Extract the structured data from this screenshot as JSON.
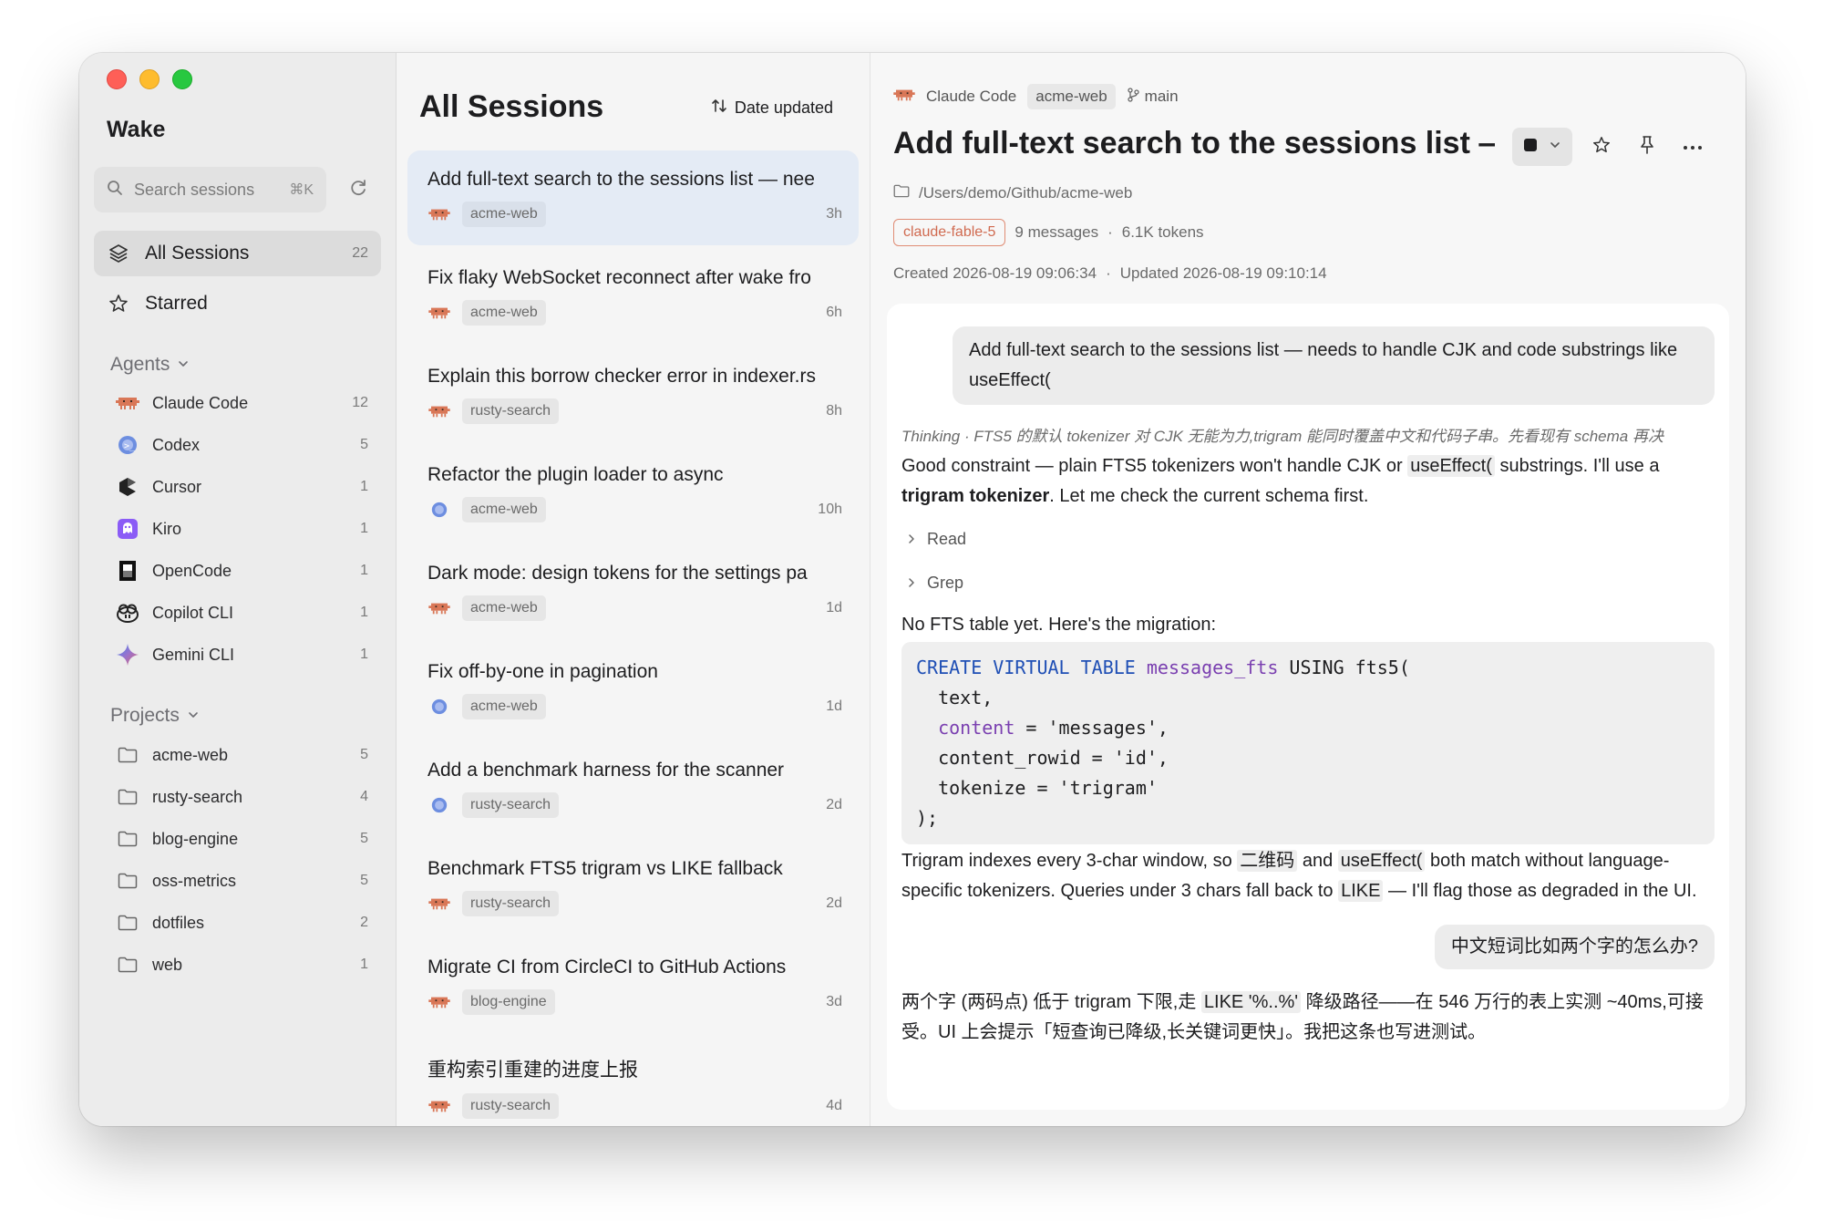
{
  "app": {
    "title": "Wake"
  },
  "sidebar": {
    "search_placeholder": "Search sessions",
    "search_shortcut": "⌘K",
    "nav": [
      {
        "label": "All Sessions",
        "count": "22",
        "icon": "layers-icon"
      },
      {
        "label": "Starred",
        "count": "",
        "icon": "star-icon"
      }
    ],
    "agents_header": "Agents",
    "agents": [
      {
        "label": "Claude Code",
        "count": "12"
      },
      {
        "label": "Codex",
        "count": "5"
      },
      {
        "label": "Cursor",
        "count": "1"
      },
      {
        "label": "Kiro",
        "count": "1"
      },
      {
        "label": "OpenCode",
        "count": "1"
      },
      {
        "label": "Copilot CLI",
        "count": "1"
      },
      {
        "label": "Gemini CLI",
        "count": "1"
      }
    ],
    "projects_header": "Projects",
    "projects": [
      {
        "label": "acme-web",
        "count": "5"
      },
      {
        "label": "rusty-search",
        "count": "4"
      },
      {
        "label": "blog-engine",
        "count": "5"
      },
      {
        "label": "oss-metrics",
        "count": "5"
      },
      {
        "label": "dotfiles",
        "count": "2"
      },
      {
        "label": "web",
        "count": "1"
      }
    ]
  },
  "sessions": {
    "title": "All Sessions",
    "sort_label": "Date updated",
    "items": [
      {
        "title": "Add full-text search to the sessions list — nee",
        "project": "acme-web",
        "time": "3h",
        "agent": "claude"
      },
      {
        "title": "Fix flaky WebSocket reconnect after wake fro",
        "project": "acme-web",
        "time": "6h",
        "agent": "claude"
      },
      {
        "title": "Explain this borrow checker error in indexer.rs",
        "project": "rusty-search",
        "time": "8h",
        "agent": "claude"
      },
      {
        "title": "Refactor the plugin loader to async",
        "project": "acme-web",
        "time": "10h",
        "agent": "codex"
      },
      {
        "title": "Dark mode: design tokens for the settings pa",
        "project": "acme-web",
        "time": "1d",
        "agent": "claude"
      },
      {
        "title": "Fix off-by-one in pagination",
        "project": "acme-web",
        "time": "1d",
        "agent": "codex"
      },
      {
        "title": "Add a benchmark harness for the scanner",
        "project": "rusty-search",
        "time": "2d",
        "agent": "codex"
      },
      {
        "title": "Benchmark FTS5 trigram vs LIKE fallback",
        "project": "rusty-search",
        "time": "2d",
        "agent": "claude"
      },
      {
        "title": "Migrate CI from CircleCI to GitHub Actions",
        "project": "blog-engine",
        "time": "3d",
        "agent": "claude"
      },
      {
        "title": "重构索引重建的进度上报",
        "project": "rusty-search",
        "time": "4d",
        "agent": "claude"
      }
    ]
  },
  "detail": {
    "breadcrumb": {
      "agent": "Claude Code",
      "project": "acme-web",
      "branch": "main"
    },
    "title": "Add full-text search to the sessions list — r",
    "path": "/Users/demo/Github/acme-web",
    "model": "claude-fable-5",
    "messages": "9 messages",
    "sep": "·",
    "tokens": "6.1K tokens",
    "created": "Created 2026-08-19 09:06:34",
    "updated": "Updated 2026-08-19 09:10:14"
  },
  "conversation": {
    "user1": "Add full-text search to the sessions list — needs to handle CJK and code substrings like useEffect(",
    "thinking": "Thinking · FTS5 的默认 tokenizer 对 CJK 无能为力,trigram 能同时覆盖中文和代码子串。先看现有 schema 再决",
    "a1_p1": "Good constraint — plain FTS5 tokenizers won't handle CJK or ",
    "a1_code1": "useEffect(",
    "a1_p2": " substrings. I'll use a ",
    "a1_bold": "trigram tokenizer",
    "a1_p3": ". Let me check the current schema first.",
    "tool1": "Read",
    "tool2": "Grep",
    "a2": "No FTS table yet. Here's the migration:",
    "code": {
      "l1_kw1": "CREATE VIRTUAL TABLE",
      "l1_id": "messages_fts",
      "l1_rest": " USING fts5(",
      "l2": "  text,",
      "l3_id": "content",
      "l3_rest": " = 'messages',",
      "l4": "  content_rowid = 'id',",
      "l5": "  tokenize = 'trigram'",
      "l6": ");"
    },
    "a3_p1": "Trigram indexes every 3-char window, so ",
    "a3_c1": "二维码",
    "a3_p2": " and ",
    "a3_c2": "useEffect(",
    "a3_p3": " both match without language-specific tokenizers. Queries under 3 chars fall back to ",
    "a3_c3": "LIKE",
    "a3_p4": " — I'll flag those as degraded in the UI.",
    "user2": "中文短词比如两个字的怎么办?",
    "a4_p1": "两个字 (两码点) 低于 trigram 下限,走 ",
    "a4_c1": "LIKE '%..%'",
    "a4_p2": " 降级路径——在 546 万行的表上实测 ~40ms,可接受。UI 上会提示「短查询已降级,长关键词更快」。我把这条也写进测试。"
  },
  "colors": {
    "claude": "#d97757",
    "codex": "#5b7bd5",
    "active_row": "#e4ebf5",
    "model_badge": "#d06a50"
  }
}
